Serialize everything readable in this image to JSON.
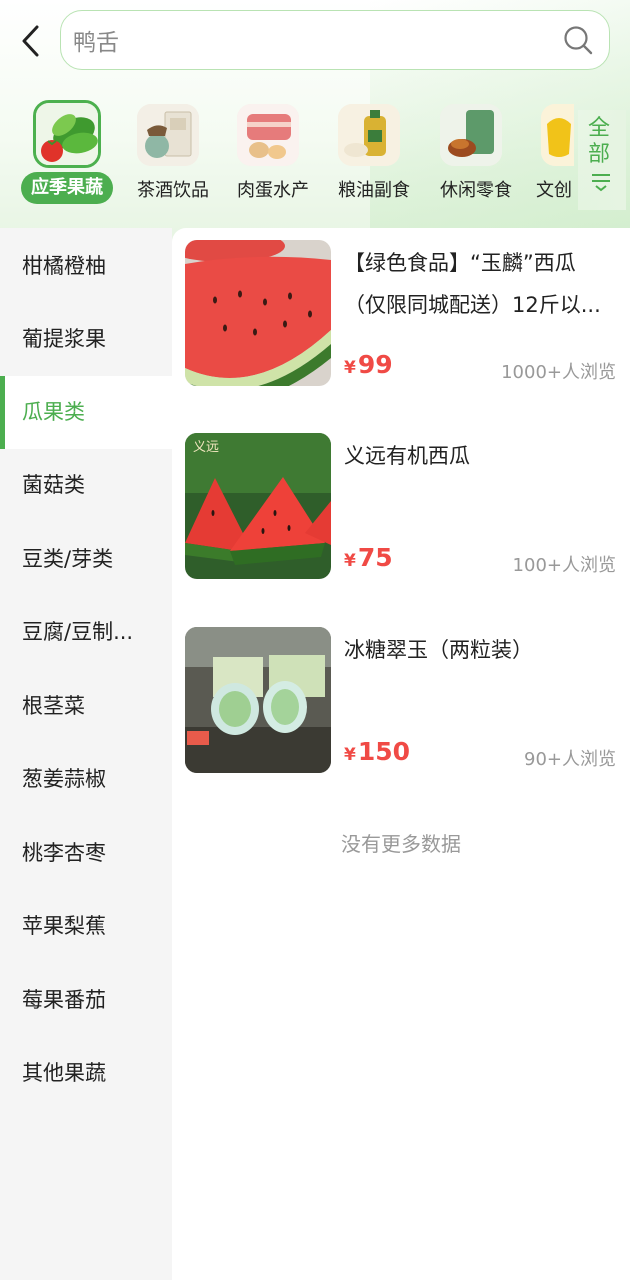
{
  "header": {
    "search": {
      "value": "鸭舌",
      "placeholder": "鸭舌"
    }
  },
  "categories": [
    {
      "label": "应季果蔬",
      "icon": "vegetable-icon",
      "active": true
    },
    {
      "label": "茶酒饮品",
      "icon": "tea-icon",
      "active": false
    },
    {
      "label": "肉蛋水产",
      "icon": "meat-icon",
      "active": false
    },
    {
      "label": "粮油副食",
      "icon": "oil-icon",
      "active": false
    },
    {
      "label": "休闲零食",
      "icon": "snack-icon",
      "active": false
    },
    {
      "label": "文创",
      "icon": "gift-icon",
      "active": false
    }
  ],
  "all_button": {
    "label": "全部"
  },
  "sidebar": {
    "items": [
      {
        "label": "柑橘橙柚"
      },
      {
        "label": "葡提浆果"
      },
      {
        "label": "瓜果类",
        "active": true
      },
      {
        "label": "菌菇类"
      },
      {
        "label": "豆类/芽类"
      },
      {
        "label": "豆腐/豆制..."
      },
      {
        "label": "根茎菜"
      },
      {
        "label": "葱姜蒜椒"
      },
      {
        "label": "桃李杏枣"
      },
      {
        "label": "苹果梨蕉"
      },
      {
        "label": "莓果番茄"
      },
      {
        "label": "其他果蔬"
      }
    ]
  },
  "products": [
    {
      "title": "【绿色食品】“玉麟”西瓜（仅限同城配送）12斤以...",
      "currency": "¥",
      "price": "99",
      "views": "1000+人浏览"
    },
    {
      "title": "义远有机西瓜",
      "currency": "¥",
      "price": "75",
      "views": "100+人浏览",
      "thumb_text": "义远"
    },
    {
      "title": "冰糖翠玉（两粒装）",
      "currency": "¥",
      "price": "150",
      "views": "90+人浏览"
    }
  ],
  "footer_text": "没有更多数据",
  "colors": {
    "accent": "#4cae4f",
    "price": "#f04a45",
    "muted": "#999999",
    "sidebar_bg": "#f5f5f5"
  }
}
